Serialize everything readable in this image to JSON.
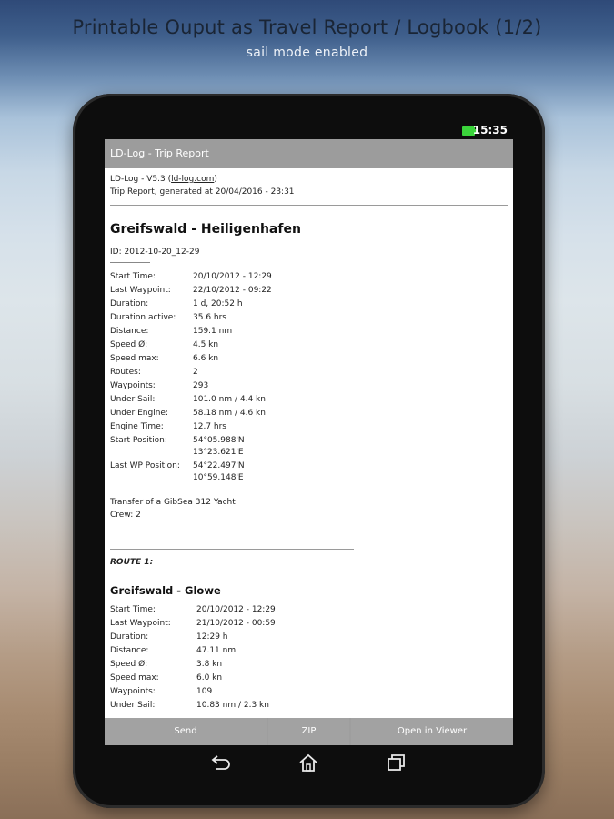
{
  "banner": {
    "title": "Printable Ouput as Travel Report / Logbook (1/2)",
    "subtitle": "sail mode enabled"
  },
  "status_bar": {
    "time": "15:35",
    "battery_icon": "battery-icon"
  },
  "app_bar": {
    "title": "LD-Log - Trip Report"
  },
  "report": {
    "version_prefix": "LD-Log - V5.3 (",
    "version_link": "ld-log.com",
    "version_suffix": ")",
    "generated": "Trip Report, generated at 20/04/2016 - 23:31",
    "trip_title": "Greifswald - Heiligenhafen",
    "id": "ID: 2012-10-20_12-29",
    "trip_stats": [
      {
        "label": "Start Time:",
        "value": "20/10/2012 - 12:29"
      },
      {
        "label": "Last Waypoint:",
        "value": "22/10/2012 - 09:22"
      },
      {
        "label": "Duration:",
        "value": "1 d, 20:52 h"
      },
      {
        "label": "Duration active:",
        "value": "35.6 hrs"
      },
      {
        "label": "Distance:",
        "value": "159.1 nm"
      },
      {
        "label": "Speed Ø:",
        "value": "4.5 kn"
      },
      {
        "label": "Speed max:",
        "value": "6.6 kn"
      },
      {
        "label": "Routes:",
        "value": "2"
      },
      {
        "label": "Waypoints:",
        "value": "293"
      },
      {
        "label": "Under Sail:",
        "value": "101.0 nm / 4.4 kn"
      },
      {
        "label": "Under Engine:",
        "value": "58.18 nm / 4.6 kn"
      },
      {
        "label": "Engine Time:",
        "value": "12.7 hrs"
      },
      {
        "label": "Start Position:",
        "value": "54°05.988'N",
        "value2": "13°23.621'E"
      },
      {
        "label": "Last WP Position:",
        "value": "54°22.497'N",
        "value2": "10°59.148'E"
      }
    ],
    "note": "Transfer of a GibSea 312 Yacht",
    "crew": "Crew: 2",
    "route_label": "ROUTE 1:",
    "route_title": "Greifswald - Glowe",
    "route_stats": [
      {
        "label": "Start Time:",
        "value": "20/10/2012 - 12:29"
      },
      {
        "label": "Last Waypoint:",
        "value": "21/10/2012 - 00:59"
      },
      {
        "label": "Duration:",
        "value": "12:29 h"
      },
      {
        "label": "Distance:",
        "value": "47.11 nm"
      },
      {
        "label": "Speed Ø:",
        "value": "3.8 kn"
      },
      {
        "label": "Speed max:",
        "value": "6.0 kn"
      },
      {
        "label": "Waypoints:",
        "value": "109"
      },
      {
        "label": "Under Sail:",
        "value": "10.83 nm / 2.3 kn"
      }
    ]
  },
  "buttons": {
    "send": "Send",
    "zip": "ZIP",
    "viewer": "Open in Viewer"
  },
  "nav_icons": [
    "back-icon",
    "home-icon",
    "recent-apps-icon"
  ]
}
